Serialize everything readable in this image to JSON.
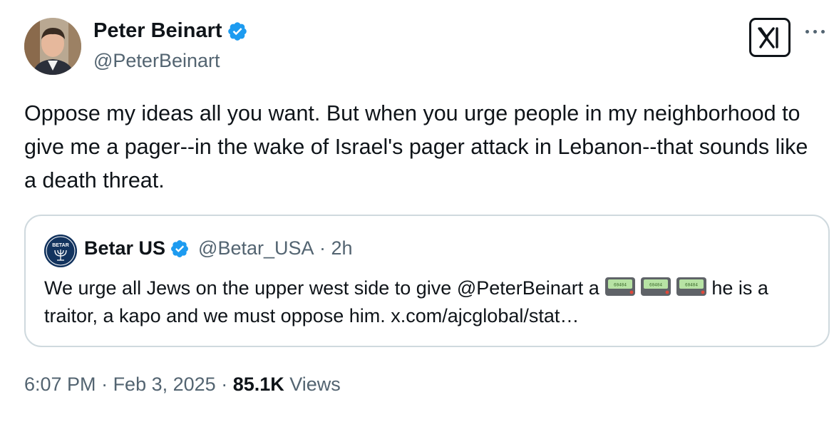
{
  "author": {
    "name": "Peter Beinart",
    "handle": "@PeterBeinart"
  },
  "tweet": {
    "text": "Oppose my ideas all you want. But when you urge people in my neighborhood to give me a pager--in the wake of Israel's pager attack in Lebanon--that sounds like a death threat."
  },
  "quote": {
    "avatar_label": "BETAR",
    "name": "Betar US",
    "handle": "@Betar_USA",
    "separator": " · ",
    "time": "2h",
    "text_before": "We urge all Jews on the upper west side to give @PeterBeinart a ",
    "pager_screen_text": "60404",
    "pager_count": 3,
    "text_after": "he is a traitor, a kapo and we must oppose him. x.com/ajcglobal/stat…"
  },
  "footer": {
    "time": "6:07 PM",
    "separator": " · ",
    "date": "Feb 3, 2025",
    "views_count": "85.1K",
    "views_label": "Views"
  },
  "icons": {
    "verified": "verified-badge-icon",
    "logo": "x-logo-icon",
    "more": "more-options-icon"
  },
  "colors": {
    "verified_blue": "#1d9bf0",
    "secondary_text": "#536471",
    "border": "#cfd9de"
  }
}
